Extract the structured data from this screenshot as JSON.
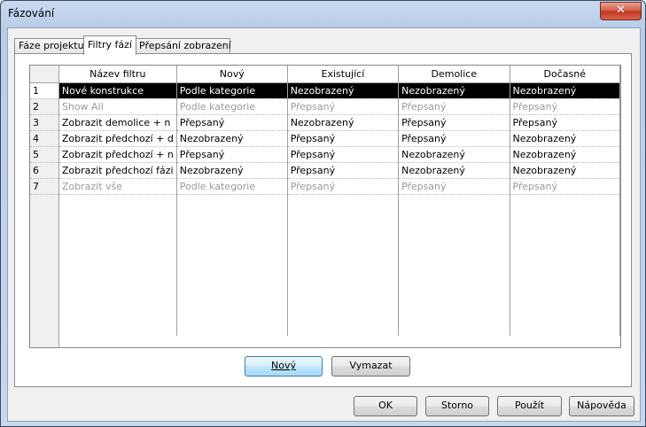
{
  "window": {
    "title": "Fázování",
    "close_glyph": "✕"
  },
  "tabs": [
    {
      "label": "Fáze projektu"
    },
    {
      "label": "Filtry fází"
    },
    {
      "label": "Přepsání zobrazení"
    }
  ],
  "grid": {
    "columns": [
      "Název filtru",
      "Nový",
      "Existující",
      "Demolice",
      "Dočasné"
    ],
    "rows": [
      {
        "num": "1",
        "cells": [
          "Nové konstrukce",
          "Podle kategorie",
          "Nezobrazený",
          "Nezobrazený",
          "Nezobrazený"
        ]
      },
      {
        "num": "2",
        "cells": [
          "Show All",
          "Podle kategorie",
          "Přepsaný",
          "Přepsaný",
          "Přepsaný"
        ]
      },
      {
        "num": "3",
        "cells": [
          "Zobrazit demolice + n",
          "Přepsaný",
          "Nezobrazený",
          "Přepsaný",
          "Přepsaný"
        ]
      },
      {
        "num": "4",
        "cells": [
          "Zobrazit předchozí + d",
          "Nezobrazený",
          "Přepsaný",
          "Přepsaný",
          "Nezobrazený"
        ]
      },
      {
        "num": "5",
        "cells": [
          "Zobrazit předchozí + n",
          "Přepsaný",
          "Přepsaný",
          "Nezobrazený",
          "Nezobrazený"
        ]
      },
      {
        "num": "6",
        "cells": [
          "Zobrazit předchozí fázi",
          "Nezobrazený",
          "Přepsaný",
          "Nezobrazený",
          "Nezobrazený"
        ]
      },
      {
        "num": "7",
        "cells": [
          "Zobrazit vše",
          "Podle kategorie",
          "Přepsaný",
          "Přepsaný",
          "Přepsaný"
        ]
      }
    ]
  },
  "buttons": {
    "new": "Nový",
    "delete": "Vymazat",
    "ok": "OK",
    "cancel": "Storno",
    "apply": "Použít",
    "help": "Nápověda"
  }
}
